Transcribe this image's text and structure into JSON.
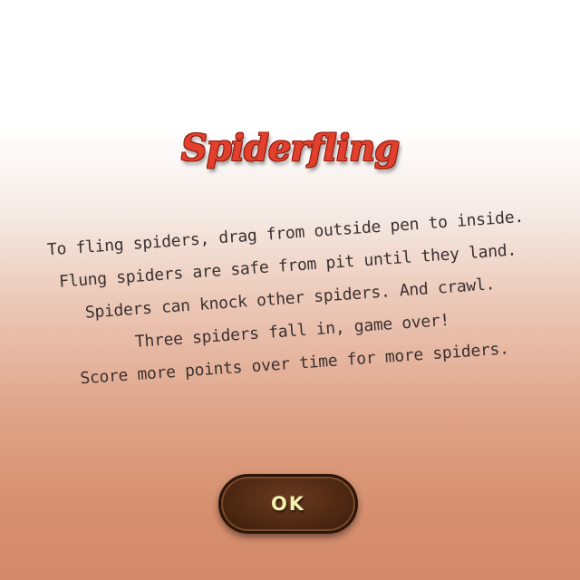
{
  "title": "Spiderfling",
  "instructions": [
    "To fling spiders, drag from outside pen to inside.",
    "Flung spiders are safe from pit until they land.",
    "Spiders can knock other spiders. And crawl.",
    "Three spiders fall in, game over!",
    "Score more points over time for more spiders."
  ],
  "ok_button": {
    "label": "OK"
  },
  "colors": {
    "title": "#e2402d",
    "text": "#3b3130",
    "button": "#4e2812",
    "button_text": "#f6f2b0"
  }
}
